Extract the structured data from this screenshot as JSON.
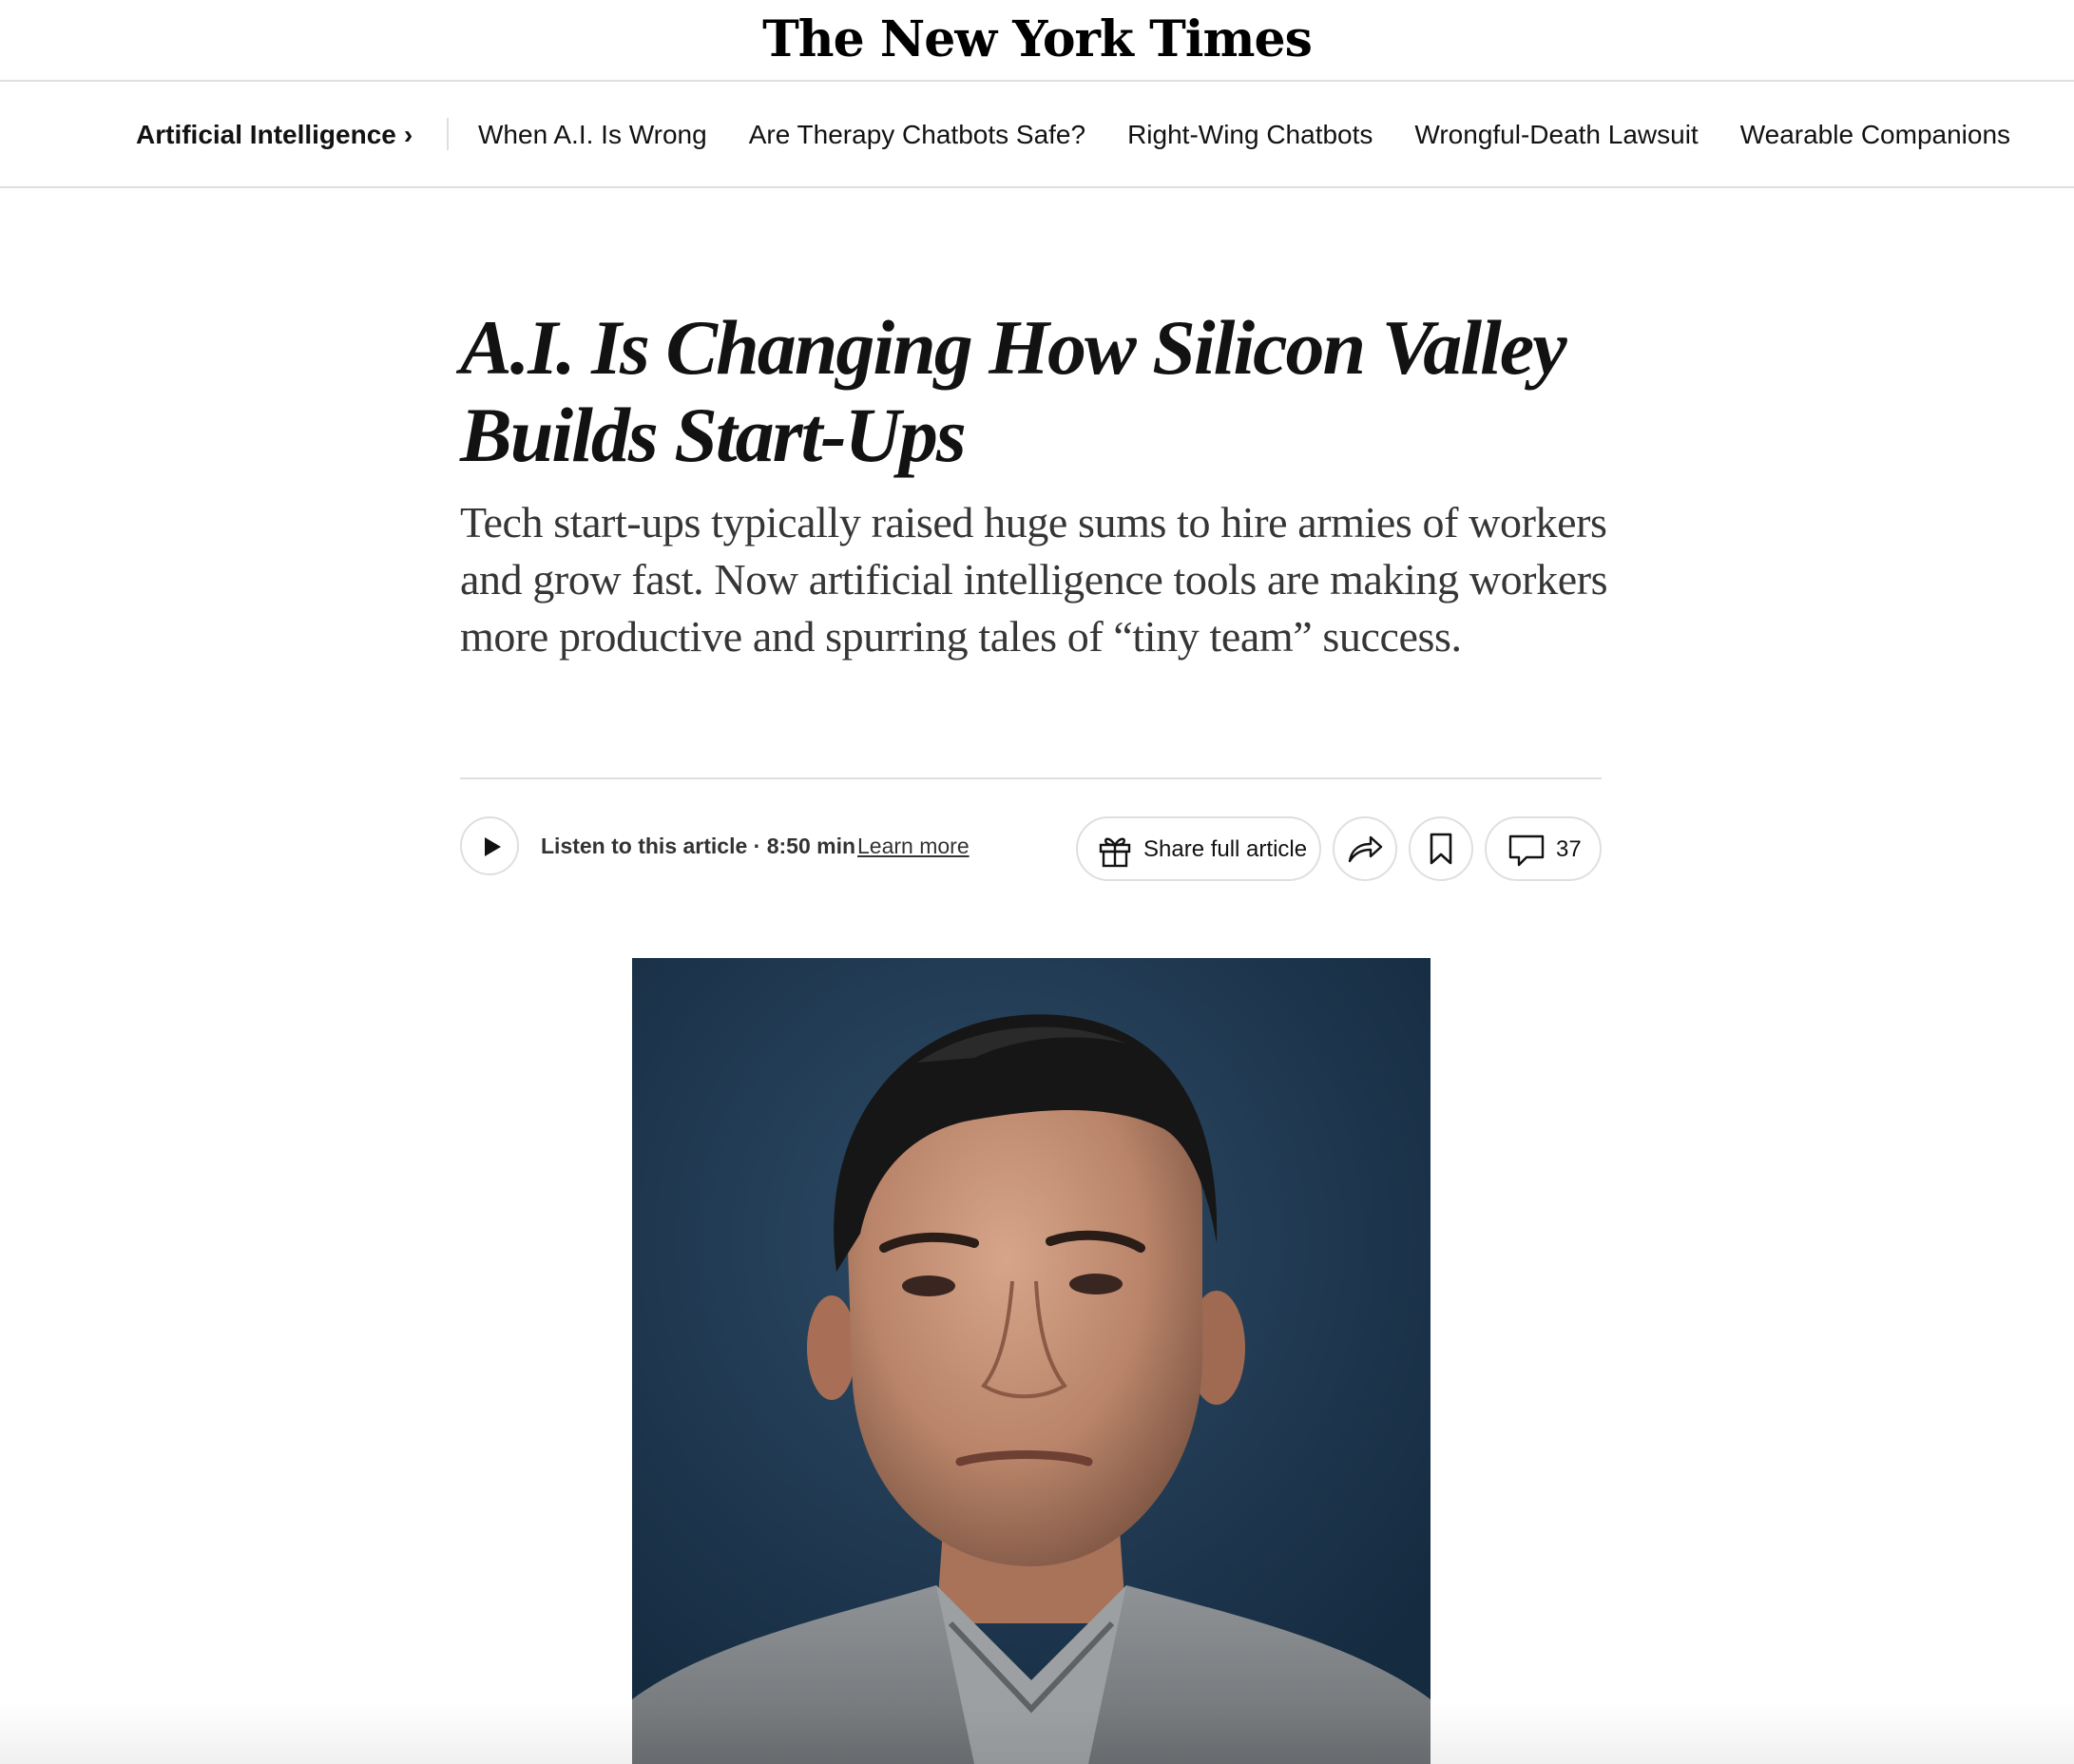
{
  "masthead": {
    "logo_text": "The New York Times"
  },
  "subnav": {
    "section_label": "Artificial Intelligence",
    "section_chevron": "›",
    "links": [
      "When A.I. Is Wrong",
      "Are Therapy Chatbots Safe?",
      "Right-Wing Chatbots",
      "Wrongful-Death Lawsuit",
      "Wearable Companions"
    ]
  },
  "article": {
    "headline": "A.I. Is Changing How Silicon Valley Builds Start-Ups",
    "summary": "Tech start-ups typically raised huge sums to hire armies of workers and grow fast. Now artificial intelligence tools are making workers more productive and spurring tales of “tiny team” success."
  },
  "toolbar": {
    "listen_label": "Listen to this article · 8:50 min",
    "learn_more_label": "Learn more",
    "share_full_label": "Share full article",
    "comment_count": "37",
    "icons": {
      "play": "play-icon",
      "gift": "gift-icon",
      "share": "share-arrow-icon",
      "bookmark": "bookmark-icon",
      "comment": "comment-icon"
    }
  },
  "colors": {
    "text": "#121212",
    "summary_text": "#363636",
    "divider": "#dfdfdf",
    "photo_background": "#1e3852"
  }
}
